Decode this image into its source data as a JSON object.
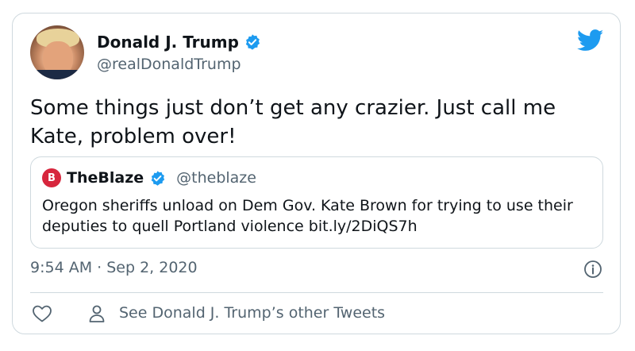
{
  "author": {
    "display_name": "Donald J. Trump",
    "handle": "@realDonaldTrump",
    "verified": true
  },
  "tweet": {
    "text": "Some things just don’t get any crazier. Just call me Kate, problem over!",
    "timestamp": "9:54 AM · Sep 2, 2020"
  },
  "quoted": {
    "logo_text": "B",
    "display_name": "TheBlaze",
    "handle": "@theblaze",
    "verified": true,
    "text": "Oregon sheriffs unload on Dem Gov. Kate Brown for trying to use their deputies to quell Portland violence bit.ly/2DiQS7h"
  },
  "footer": {
    "see_other_label": "See Donald J. Trump’s other Tweets"
  },
  "icons": {
    "brand": "twitter-bird-icon",
    "verified": "verified-badge-icon",
    "info": "info-icon",
    "like": "heart-icon",
    "profile": "user-icon"
  },
  "colors": {
    "twitter_blue": "#1d9bf0",
    "secondary_text": "#536471",
    "border": "#cfd9de",
    "blaze_red": "#d7263d"
  }
}
